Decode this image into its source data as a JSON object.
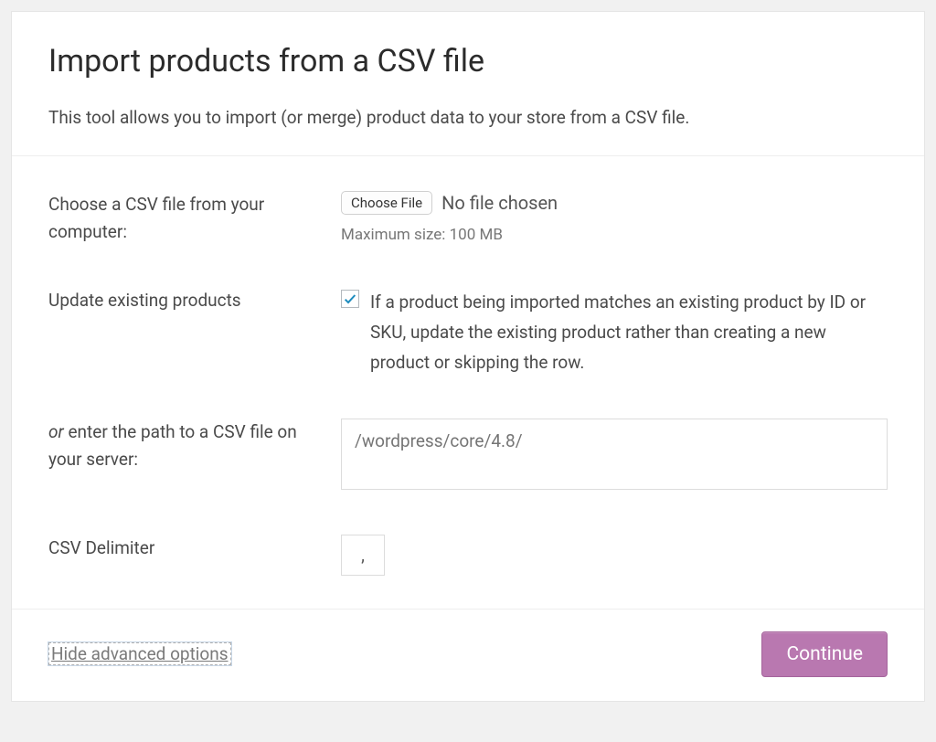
{
  "header": {
    "title": "Import products from a CSV file",
    "description": "This tool allows you to import (or merge) product data to your store from a CSV file."
  },
  "form": {
    "choose_file": {
      "label": "Choose a CSV file from your computer:",
      "button": "Choose File",
      "status": "No file chosen",
      "hint": "Maximum size: 100 MB"
    },
    "update_existing": {
      "label": "Update existing products",
      "checked": true,
      "description": "If a product being imported matches an existing product by ID or SKU, update the existing product rather than creating a new product or skipping the row."
    },
    "server_path": {
      "label_prefix": "or",
      "label_rest": " enter the path to a CSV file on your server:",
      "placeholder": "/wordpress/core/4.8/"
    },
    "delimiter": {
      "label": "CSV Delimiter",
      "value": ","
    }
  },
  "footer": {
    "toggle_label": "Hide advanced options",
    "continue_label": "Continue"
  }
}
